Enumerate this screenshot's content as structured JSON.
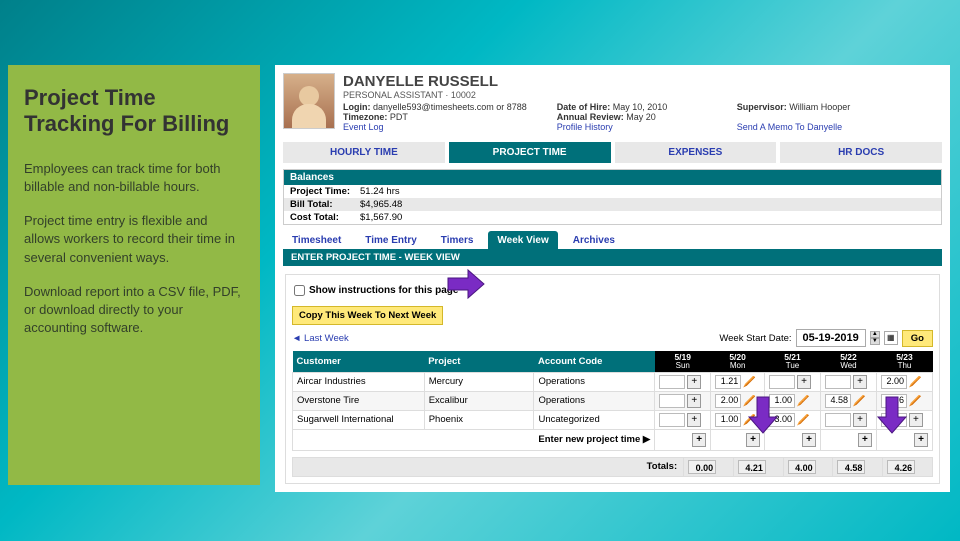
{
  "left": {
    "title": "Project Time Tracking For Billing",
    "p1": "Employees can track time for both billable and non-billable hours.",
    "p2": "Project time entry is flexible and allows workers to record their time in several convenient ways.",
    "p3": "Download report into a CSV file, PDF, or download directly to your accounting software."
  },
  "employee": {
    "name": "DANYELLE RUSSELL",
    "role": "PERSONAL ASSISTANT · 10002",
    "login_label": "Login:",
    "login": "danyelle593@timesheets.com  or  8788",
    "tz_label": "Timezone:",
    "tz": "PDT",
    "event_log": "Event Log",
    "hire_label": "Date of Hire:",
    "hire": "May 10, 2010",
    "review_label": "Annual Review:",
    "review": "May 20",
    "profile_history": "Profile History",
    "sup_label": "Supervisor:",
    "sup": "William Hooper",
    "memo": "Send A Memo To Danyelle"
  },
  "mainTabs": {
    "hourly": "HOURLY TIME",
    "project": "PROJECT TIME",
    "expenses": "EXPENSES",
    "hr": "HR DOCS"
  },
  "balances": {
    "head": "Balances",
    "pt_label": "Project Time:",
    "pt": "51.24 hrs",
    "bt_label": "Bill Total:",
    "bt": "$4,965.48",
    "ct_label": "Cost Total:",
    "ct": "$1,567.90"
  },
  "subTabs": {
    "timesheet": "Timesheet",
    "timeentry": "Time Entry",
    "timers": "Timers",
    "weekview": "Week View",
    "archives": "Archives"
  },
  "section_title": "ENTER PROJECT TIME - WEEK VIEW",
  "instr": "Show instructions for this page",
  "copy_btn": "Copy This Week To Next Week",
  "last_week": "Last Week",
  "week_start_label": "Week Start Date:",
  "week_start_date": "05-19-2019",
  "go": "Go",
  "cols": {
    "customer": "Customer",
    "project": "Project",
    "account": "Account Code"
  },
  "days": [
    {
      "d": "5/19",
      "n": "Sun"
    },
    {
      "d": "5/20",
      "n": "Mon"
    },
    {
      "d": "5/21",
      "n": "Tue"
    },
    {
      "d": "5/22",
      "n": "Wed"
    },
    {
      "d": "5/23",
      "n": "Thu"
    }
  ],
  "rows": [
    {
      "customer": "Aircar Industries",
      "project": "Mercury",
      "account": "Operations",
      "vals": [
        "",
        "1.21",
        "",
        "",
        "2.00"
      ]
    },
    {
      "customer": "Overstone Tire",
      "project": "Excalibur",
      "account": "Operations",
      "vals": [
        "",
        "2.00",
        "1.00",
        "4.58",
        "2.26"
      ]
    },
    {
      "customer": "Sugarwell International",
      "project": "Phoenix",
      "account": "Uncategorized",
      "vals": [
        "",
        "1.00",
        "3.00",
        "",
        ""
      ]
    }
  ],
  "enter_new": "Enter new project time",
  "totals_label": "Totals:",
  "totals": [
    "0.00",
    "4.21",
    "4.00",
    "4.58",
    "4.26"
  ]
}
